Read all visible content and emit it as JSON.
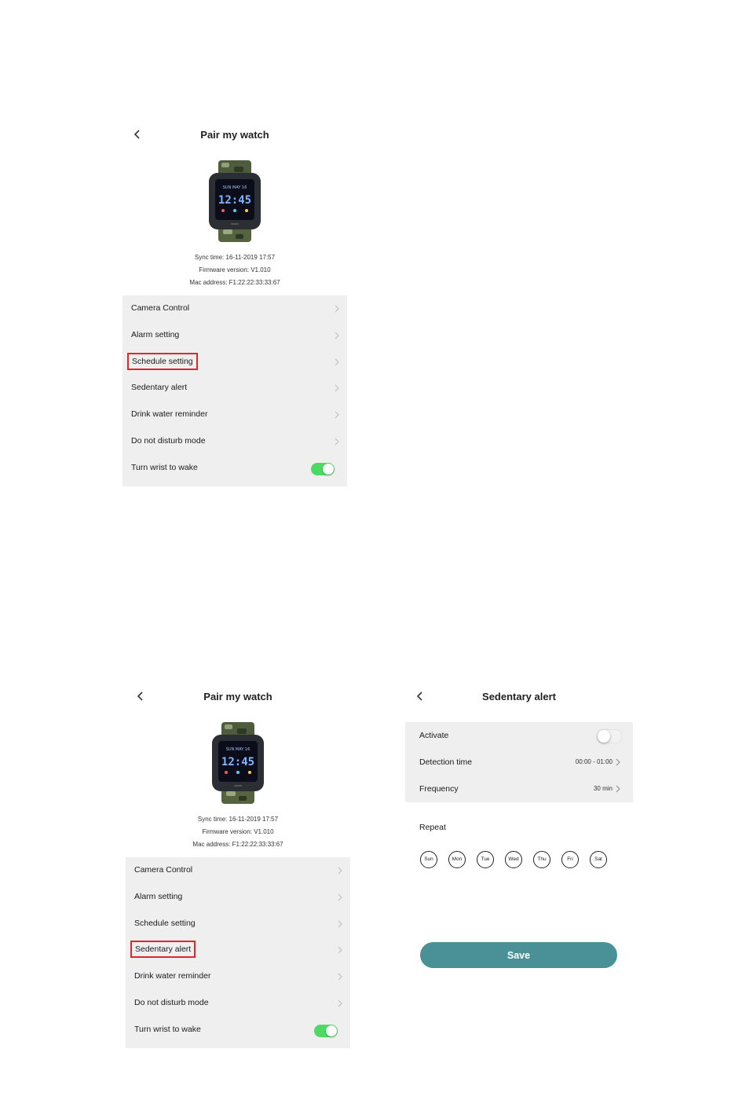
{
  "pair_screen": {
    "title": "Pair my watch",
    "watch": {
      "date_line": "SUN MAY 16",
      "time": "12:45"
    },
    "sync_time": "Sync time: 16-11-2019 17:57",
    "firmware": "Firmware version: V1.010",
    "mac": "Mac address: F1:22:22:33:33:67",
    "menu": [
      "Camera Control",
      "Alarm setting",
      "Schedule setting",
      "Sedentary alert",
      "Drink water reminder",
      "Do not disturb mode",
      "Turn wrist to wake"
    ],
    "turn_wrist_enabled": true
  },
  "annotations": {
    "screen1_highlight": "Schedule setting",
    "screen2_highlight": "Sedentary alert"
  },
  "sedentary_screen": {
    "title": "Sedentary alert",
    "activate_label": "Activate",
    "activate_on": false,
    "detection_label": "Detection time",
    "detection_value": "00:00 - 01:00",
    "frequency_label": "Frequency",
    "frequency_value": "30 min",
    "repeat_label": "Repeat",
    "days": [
      "Sun",
      "Mon",
      "Tue",
      "Wed",
      "Thu",
      "Fri",
      "Sat"
    ],
    "save_label": "Save"
  },
  "colors": {
    "toggle_on": "#4cd964",
    "highlight_box": "#e0262b",
    "save_button": "#4a9197",
    "panel_bg": "#efefef"
  },
  "icons": [
    "back-chevron-icon",
    "chevron-right-icon",
    "smartwatch-image"
  ]
}
